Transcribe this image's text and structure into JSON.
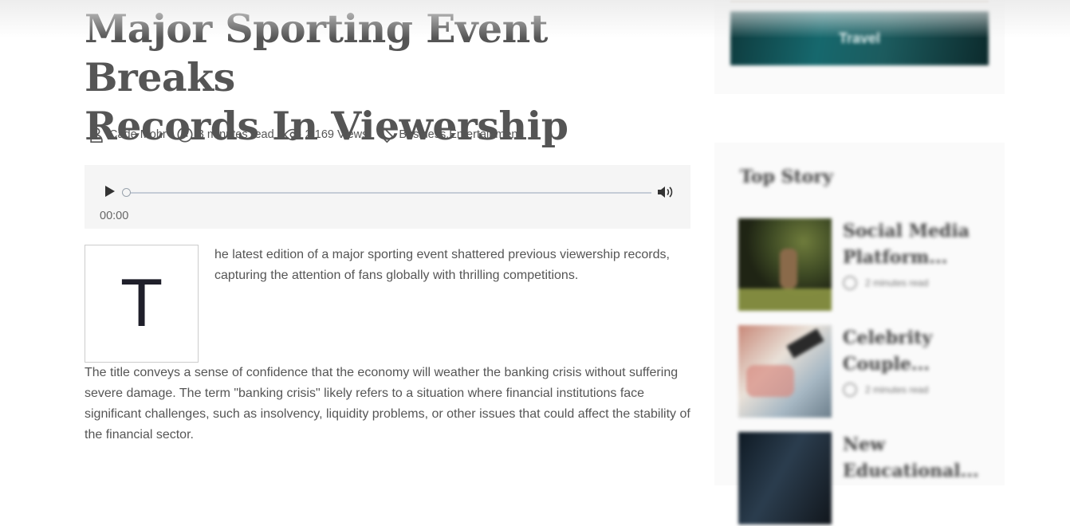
{
  "article": {
    "title_line1": "Major Sporting Event Breaks",
    "title_line2": "Records In Viewership",
    "meta": {
      "author": "Cade Mohr",
      "read_time": "3 minutes read",
      "views": "2,169 Views",
      "categories": "Business,Entertainment"
    },
    "audio": {
      "current_time": "00:00",
      "progress": 0
    },
    "dropcap": "T",
    "para1": "he latest edition of a major sporting event shattered previous viewership records, capturing the attention of fans globally with thrilling competitions.",
    "para2": "The title conveys a sense of confidence that the economy will weather the banking crisis without suffering severe damage. The term \"banking crisis\" likely refers to a situation where financial institutions face significant challenges, such as insolvency, liquidity problems, or other issues that could affect the stability of the financial sector."
  },
  "sidebar": {
    "banner_label": "Travel",
    "top_story_heading": "Top Story",
    "stories": [
      {
        "title": "Social Media Platform...",
        "read_time": "2 minutes read"
      },
      {
        "title": "Celebrity Couple...",
        "read_time": "2 minutes read"
      },
      {
        "title": "New Educational...",
        "read_time": ""
      }
    ]
  },
  "colors": {
    "text": "#555555",
    "player_bg": "#f5f5f5",
    "banner": "#16686d"
  }
}
